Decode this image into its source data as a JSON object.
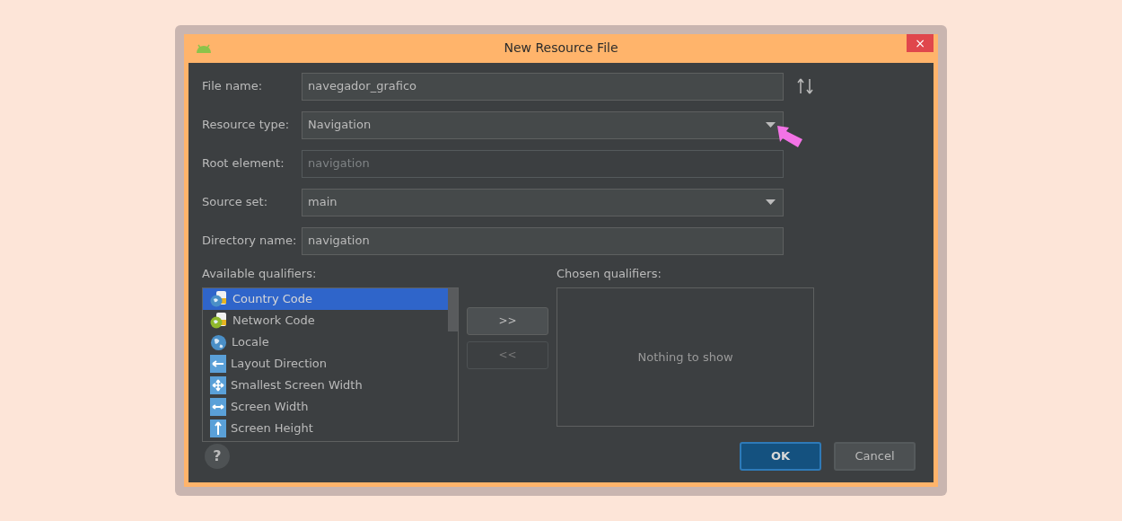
{
  "window": {
    "title": "New Resource File",
    "close": "×"
  },
  "fields": [
    {
      "label": "File name:",
      "value": "navegador_grafico",
      "kind": "text",
      "disabled": false
    },
    {
      "label": "Resource type:",
      "value": "Navigation",
      "kind": "dropdown",
      "disabled": false
    },
    {
      "label": "Root element:",
      "value": "navigation",
      "kind": "text",
      "disabled": true
    },
    {
      "label": "Source set:",
      "value": "main",
      "kind": "dropdown",
      "disabled": false
    },
    {
      "label": "Directory name:",
      "value": "navigation",
      "kind": "text",
      "disabled": false
    }
  ],
  "available_qualifiers": {
    "label": "Available qualifiers:",
    "items": [
      {
        "name": "Country Code",
        "kind": "country",
        "selected": true
      },
      {
        "name": "Network Code",
        "kind": "network",
        "selected": false
      },
      {
        "name": "Locale",
        "kind": "globe",
        "selected": false
      },
      {
        "name": "Layout Direction",
        "kind": "direction",
        "selected": false
      },
      {
        "name": "Smallest Screen Width",
        "kind": "smallest",
        "selected": false
      },
      {
        "name": "Screen Width",
        "kind": "width",
        "selected": false
      },
      {
        "name": "Screen Height",
        "kind": "height",
        "selected": false
      }
    ]
  },
  "move_buttons": [
    {
      "label": ">>",
      "disabled": false
    },
    {
      "label": "<<",
      "disabled": true
    }
  ],
  "chosen_qualifiers": {
    "label": "Chosen qualifiers:",
    "empty_text": "Nothing to show"
  },
  "help": "?",
  "buttons": [
    {
      "label": "OK",
      "kind": "primary"
    },
    {
      "label": "Cancel",
      "kind": "secondary"
    }
  ]
}
